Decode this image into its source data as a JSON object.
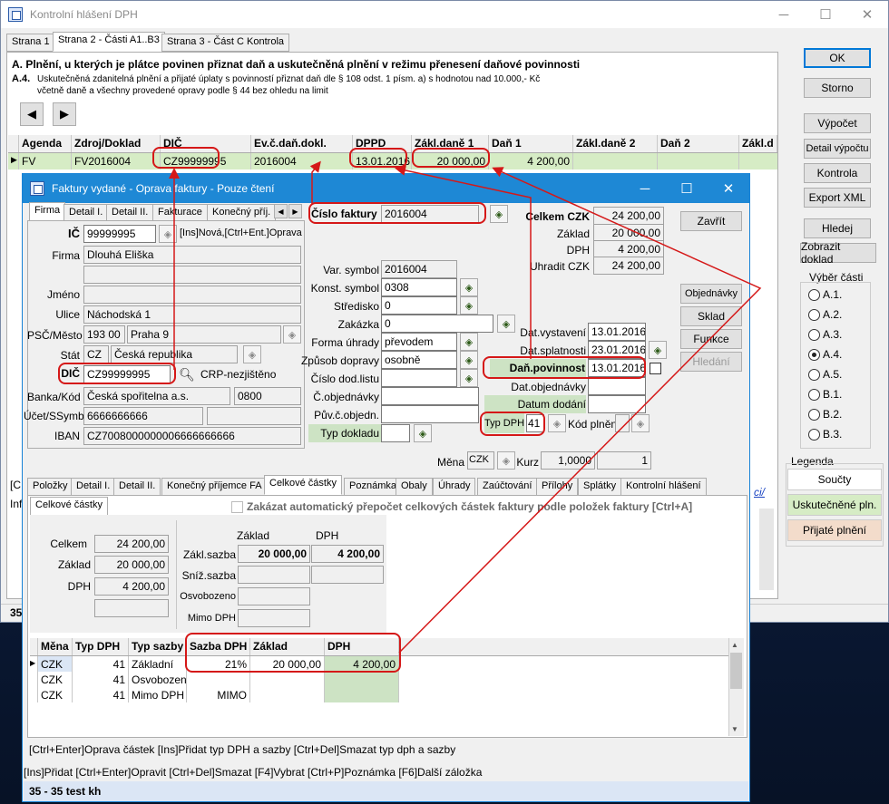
{
  "main": {
    "title": "Kontrolní hlášení DPH",
    "tabs": [
      "Strana 1",
      "Strana 2 - Části A1..B3",
      "Strana 3 - Část C Kontrola"
    ],
    "heading": "A. Plnění, u kterých je plátce povinen přiznat daň a uskutečněná plnění v režimu přenesení daňové povinnosti",
    "section_code": "A.4.",
    "section_text_1": "Uskutečněná zdanitelná plnění a přijaté úplaty s povinností přiznat daň dle § 108 odst. 1 písm. a) s hodnotou nad 10.000,- Kč",
    "section_text_2": "včetně daně a všechny provedené opravy podle § 44 bez ohledu na limit",
    "columns": [
      "Agenda",
      "Zdroj/Doklad",
      "DIČ",
      "Ev.č.daň.dokl.",
      "DPPD",
      "Zákl.daně 1",
      "Daň 1",
      "Zákl.daně 2",
      "Daň 2",
      "Zákl.d"
    ],
    "row": [
      "FV",
      "FV2016004",
      "CZ99999995",
      "2016004",
      "13.01.2016",
      "20 000,00",
      "4 200,00"
    ],
    "buttons": {
      "ok": "OK",
      "storno": "Storno",
      "vypocet": "Výpočet",
      "detail": "Detail výpočtu",
      "kontrola": "Kontrola",
      "export": "Export XML",
      "hledej": "Hledej",
      "zobrazit": "Zobrazit doklad"
    },
    "vyber_title": "Výběr části",
    "options": [
      "A.1.",
      "A.2.",
      "A.3.",
      "A.4.",
      "A.5.",
      "B.1.",
      "B.2.",
      "B.3."
    ],
    "legenda": "Legenda",
    "legend_items": [
      "Součty",
      "Uskutečněné pln.",
      "Přijaté plnění"
    ],
    "status": "35 - 35 test kh",
    "status_short": "35",
    "frag_inf": "Inf",
    "frag_bracket": "[C",
    "frag_link": "ci/"
  },
  "dlg": {
    "title": "Faktury vydané - Oprava faktury - Pouze čtení",
    "tabs": [
      "Firma",
      "Detail I.",
      "Detail II.",
      "Fakturace",
      "Konečný příj."
    ],
    "ic_label": "IČ",
    "ic": "99999995",
    "ins_hint": "[Ins]Nová,[Ctrl+Ent.]Oprava",
    "firma_label": "Firma",
    "firma": "Dlouhá Eliška",
    "jmeno_label": "Jméno",
    "ulice_label": "Ulice",
    "ulice": "Náchodská 1",
    "psc_label": "PSČ/Město",
    "psc": "193 00",
    "mesto": "Praha 9",
    "stat_label": "Stát",
    "stat_code": "CZ",
    "stat": "Česká republika",
    "dic_label": "DIČ",
    "dic": "CZ99999995",
    "crp": "CRP-nezjištěno",
    "banka_label": "Banka/Kód",
    "banka": "Česká spořitelna a.s.",
    "kod": "0800",
    "ucet_label": "Účet/SSymb",
    "ucet": "6666666666",
    "iban_label": "IBAN",
    "iban": "CZ7008000000006666666666",
    "cislo_label": "Číslo faktury",
    "cislo": "2016004",
    "var_label": "Var. symbol",
    "var": "2016004",
    "konst_label": "Konst. symbol",
    "konst": "0308",
    "stredisko_label": "Středisko",
    "stredisko": "0",
    "zakazka_label": "Zakázka",
    "zakazka": "0",
    "forma_label": "Forma úhrady",
    "forma": "převodem",
    "doprava_label": "Způsob dopravy",
    "doprava": "osobně",
    "dodlist_label": "Číslo dod.listu",
    "cobj_label": "Č.objednávky",
    "puvc_label": "Pův.č.objedn.",
    "typdokl_label": "Typ dokladu",
    "celkem_label": "Celkem CZK",
    "celkem": "24 200,00",
    "zaklad_label": "Základ",
    "zaklad": "20 000,00",
    "dph_label": "DPH",
    "dph": "4 200,00",
    "uhradit_label": "Uhradit CZK",
    "uhradit": "24 200,00",
    "datvyst_label": "Dat.vystavení",
    "datvyst": "13.01.2016",
    "datspl_label": "Dat.splatnosti",
    "datspl": "23.01.2016",
    "danpov_label": "Daň.povinnost",
    "danpov": "13.01.2016",
    "datobj_label": "Dat.objednávky",
    "datdod_label": "Datum dodání",
    "typdph_label": "Typ DPH",
    "typdph": "41",
    "kodpl_label": "Kód plnění",
    "mena_label": "Měna",
    "mena": "CZK",
    "kurz_label": "Kurz",
    "kurz": "1,0000",
    "kurz2": "1",
    "btns": {
      "zavrit": "Zavřít",
      "objednavky": "Objednávky",
      "sklad": "Sklad",
      "funkce": "Funkce",
      "hledani": "Hledání"
    },
    "tabs2": [
      "Položky",
      "Detail I.",
      "Detail II.",
      "Konečný příjemce FA",
      "Celkové částky",
      "Poznámka",
      "Obaly",
      "Úhrady",
      "Zaúčtování",
      "Přílohy",
      "Splátky",
      "Kontrolní hlášení"
    ],
    "subtab": "Celkové částky",
    "zakazat": "Zakázat automatický přepočet celkových částek faktury podle položek faktury [Ctrl+A]",
    "sum_celkem_label": "Celkem",
    "sum_celkem": "24 200,00",
    "sum_zaklad_label": "Základ",
    "sum_zaklad": "20 000,00",
    "sum_dph_label": "DPH",
    "sum_dph": "4 200,00",
    "col_zaklad": "Základ",
    "col_dph": "DPH",
    "zakl_sazba": "Zákl.sazba",
    "zakl_zaklad": "20 000,00",
    "zakl_dph": "4 200,00",
    "sniz_sazba": "Sníž.sazba",
    "osvobozeno": "Osvobozeno",
    "mimo": "Mimo DPH",
    "grid_cols": [
      "Měna",
      "Typ DPH",
      "Typ sazby",
      "Sazba DPH",
      "Základ",
      "DPH"
    ],
    "grid_rows": [
      [
        "CZK",
        "41",
        "Základní",
        "21%",
        "20 000,00",
        "4 200,00"
      ],
      [
        "CZK",
        "41",
        "Osvobozeno",
        "",
        "",
        ""
      ],
      [
        "CZK",
        "41",
        "Mimo DPH",
        "MIMO",
        "",
        ""
      ]
    ],
    "hint1": "[Ctrl+Enter]Oprava částek [Ins]Přidat typ DPH a sazby [Ctrl+Del]Smazat typ dph a sazby",
    "hint2": "[Ins]Přidat [Ctrl+Enter]Opravit [Ctrl+Del]Smazat [F4]Vybrat [Ctrl+P]Poznámka [F6]Další záložka"
  }
}
